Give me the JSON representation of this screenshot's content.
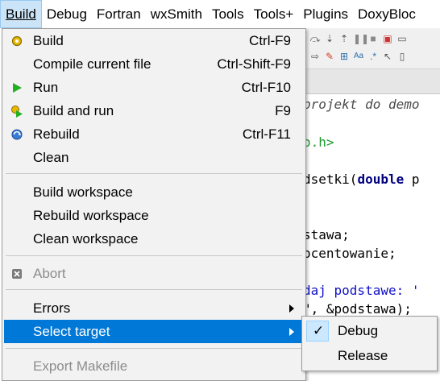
{
  "menubar": {
    "items": [
      "Build",
      "Debug",
      "Fortran",
      "wxSmith",
      "Tools",
      "Tools+",
      "Plugins",
      "DoxyBloc"
    ]
  },
  "editor": {
    "lines": [
      {
        "text": "projekt do demo",
        "cls": "c-comment"
      },
      {
        "text": "o.h>",
        "cls": "c-green"
      },
      {
        "text": "dsetki(",
        "cls": "c-plain",
        "kw": "double",
        "after": " p"
      },
      {
        "text": "stawa;",
        "cls": "c-plain",
        "red": ""
      },
      {
        "text": "ocentowanie;",
        "cls": "c-plain"
      },
      {
        "text": "daj podstawe: '",
        "cls": "c-str"
      },
      {
        "text": "\", &podstawa);",
        "cls": "c-plain"
      }
    ]
  },
  "build_menu": {
    "items": [
      {
        "label": "Build",
        "shortcut": "Ctrl-F9",
        "icon": "gear-icon",
        "enabled": true
      },
      {
        "label": "Compile current file",
        "shortcut": "Ctrl-Shift-F9",
        "icon": "",
        "enabled": true
      },
      {
        "label": "Run",
        "shortcut": "Ctrl-F10",
        "icon": "play-icon",
        "enabled": true
      },
      {
        "label": "Build and run",
        "shortcut": "F9",
        "icon": "gear-play-icon",
        "enabled": true
      },
      {
        "label": "Rebuild",
        "shortcut": "Ctrl-F11",
        "icon": "rebuild-icon",
        "enabled": true
      },
      {
        "label": "Clean",
        "shortcut": "",
        "icon": "",
        "enabled": true
      },
      {
        "label": "Build workspace",
        "shortcut": "",
        "icon": "",
        "enabled": true
      },
      {
        "label": "Rebuild workspace",
        "shortcut": "",
        "icon": "",
        "enabled": true
      },
      {
        "label": "Clean workspace",
        "shortcut": "",
        "icon": "",
        "enabled": true
      },
      {
        "label": "Abort",
        "shortcut": "",
        "icon": "abort-icon",
        "enabled": false
      },
      {
        "label": "Errors",
        "shortcut": "",
        "icon": "",
        "enabled": true,
        "submenu": true
      },
      {
        "label": "Select target",
        "shortcut": "",
        "icon": "",
        "enabled": true,
        "submenu": true,
        "highlighted": true
      },
      {
        "label": "Export Makefile",
        "shortcut": "",
        "icon": "",
        "enabled": false
      }
    ]
  },
  "target_submenu": {
    "items": [
      {
        "label": "Debug",
        "checked": true
      },
      {
        "label": "Release",
        "checked": false
      }
    ]
  },
  "colors": {
    "highlight": "#0078d7",
    "menu_bg": "#f2f2f2",
    "disabled_text": "#8c8c8c",
    "check_bg": "#cce8ff"
  }
}
